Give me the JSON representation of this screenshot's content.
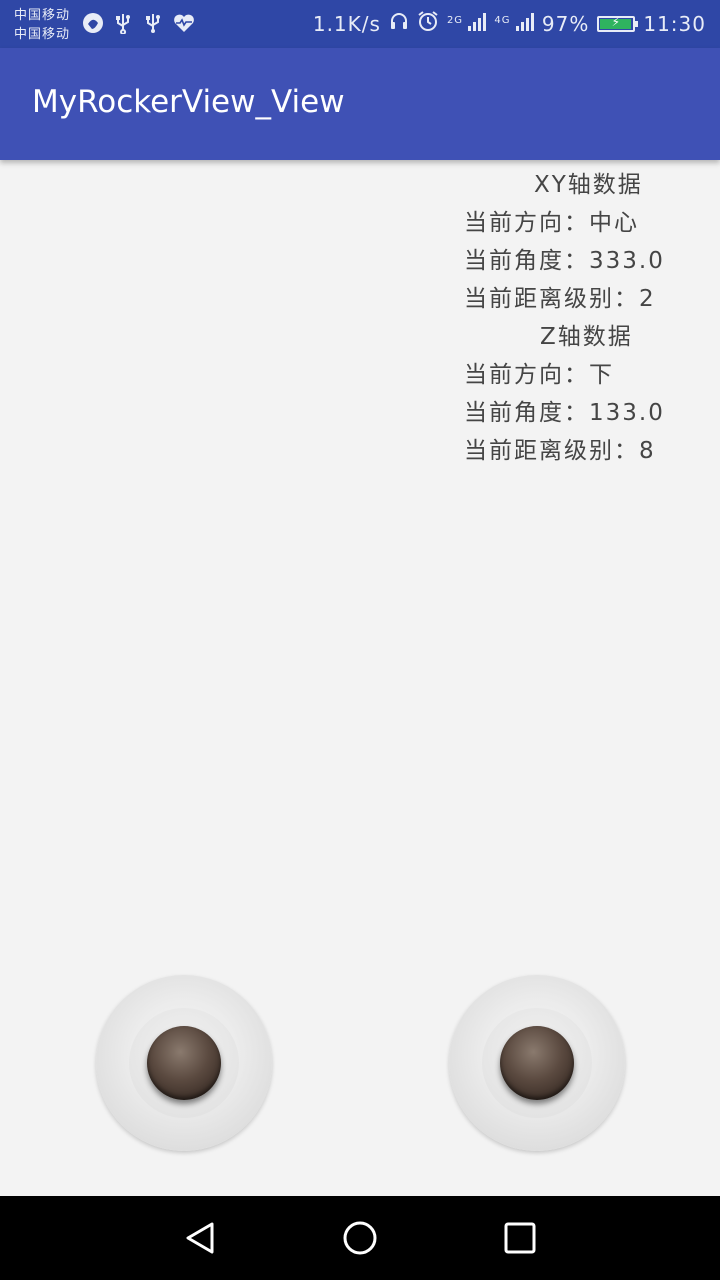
{
  "status_bar": {
    "carrier_1": "中国移动",
    "carrier_2": "中国移动",
    "left_icons": [
      "browser-icon",
      "usb-icon",
      "usb-icon",
      "heart-pulse-icon"
    ],
    "net_speed": "1.1K/s",
    "net_2g": "2G",
    "net_4g": "4G",
    "battery": "97%",
    "time": "11:30"
  },
  "app_bar": {
    "title": "MyRockerView_View"
  },
  "xy_data": {
    "header": "XY轴数据",
    "direction": "当前方向：中心",
    "angle": "当前角度：333.0",
    "level": "当前距离级别：2"
  },
  "z_data": {
    "header": "Z轴数据",
    "direction": "当前方向：下",
    "angle": "当前角度：133.0",
    "level": "当前距离级别：8"
  },
  "nav_bar": {
    "icons": [
      "back-icon",
      "home-icon",
      "recents-icon"
    ]
  },
  "colors": {
    "status_bar": "#2f47a6",
    "app_bar": "#3f51b5",
    "background": "#f3f3f3",
    "text": "#454545"
  }
}
